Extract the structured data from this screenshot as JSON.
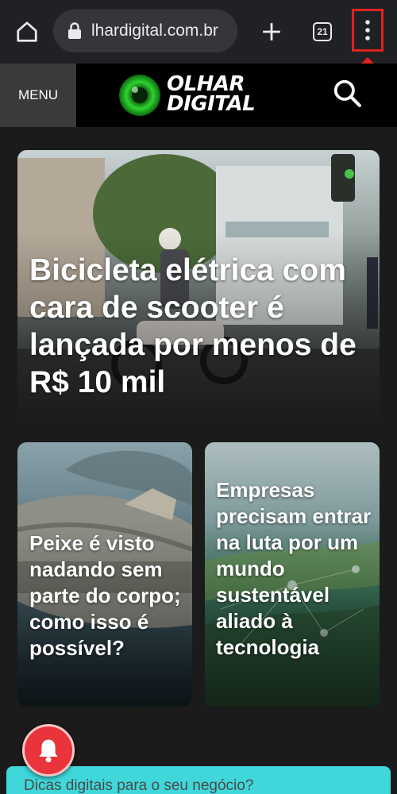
{
  "browser": {
    "url": "lhardigital.com.br",
    "tab_count": "21",
    "icons": [
      "home-icon",
      "lock-icon",
      "plus-icon",
      "tabs-icon",
      "more-vert-icon",
      "arrow-up-icon"
    ]
  },
  "site_header": {
    "menu_label": "MENU",
    "logo_line1": "OLHAR",
    "logo_line2": "DIGITAL",
    "search_icon": "search-icon"
  },
  "articles": [
    {
      "title": "Bicicleta elétrica com cara de scooter é lançada por menos de R$ 10 mil"
    },
    {
      "title": "Peixe é visto nadando sem parte do corpo; como isso é possível?"
    },
    {
      "title": "Empresas precisam entrar na luta por um mundo sustentável aliado à tecnologia"
    }
  ],
  "banner": {
    "text": "Dicas digitais para o seu negócio?"
  },
  "colors": {
    "browser_bar": "#202124",
    "site_header": "#000000",
    "page_bg": "#1b1b1b",
    "highlight": "#e0231f",
    "logo_green": "#1db51d",
    "bell": "#e8343a",
    "banner": "#3fd7d9"
  }
}
